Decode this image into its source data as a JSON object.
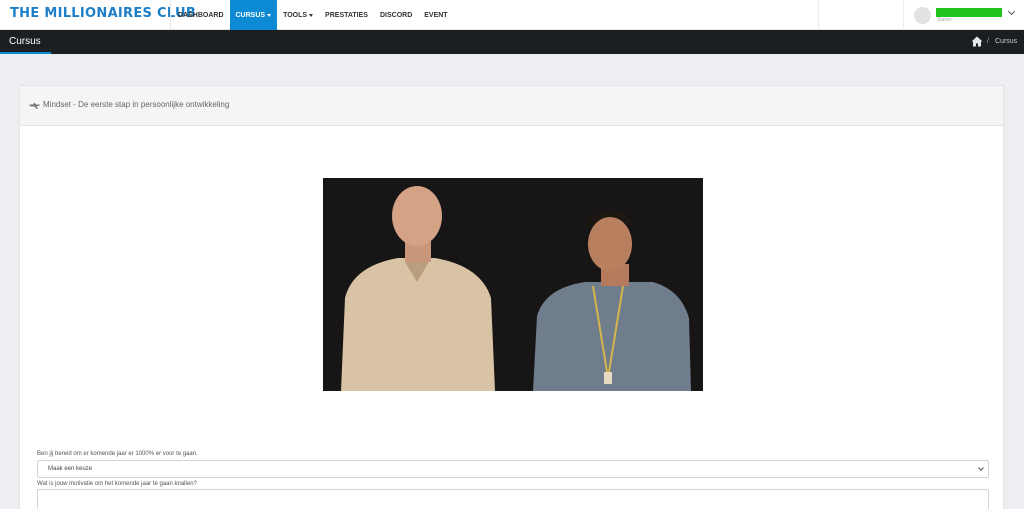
{
  "brand": {
    "logo_text": "THE MILLIONAIRES CLUB",
    "accent": "#0c8bd4",
    "logo_color": "#1d7fc7"
  },
  "nav": {
    "items": [
      {
        "label": "DASHBOARD",
        "active": false,
        "dropdown": false
      },
      {
        "label": "CURSUS",
        "active": true,
        "dropdown": true
      },
      {
        "label": "TOOLS",
        "active": false,
        "dropdown": true
      },
      {
        "label": "PRESTATIES",
        "active": false,
        "dropdown": false
      },
      {
        "label": "DISCORD",
        "active": false,
        "dropdown": false
      },
      {
        "label": "EVENT",
        "active": false,
        "dropdown": false
      }
    ]
  },
  "user": {
    "role": "Starter",
    "name_bar_color": "#22c51b"
  },
  "page": {
    "title": "Cursus",
    "breadcrumb": {
      "home_icon": "home-icon",
      "current": "Cursus"
    }
  },
  "card": {
    "header_icon": "hand-pointer-icon",
    "title": "Mindset - De eerste stap in persoonlijke ontwikkeling"
  },
  "form": {
    "question1": "Ben jij bereid om er komende jaar er 1000% er voor te gaan.",
    "select_value": "Maak een keuze",
    "question2": "Wat is jouw motivatie om het komende jaar te gaan knallen?",
    "textarea_value": ""
  }
}
